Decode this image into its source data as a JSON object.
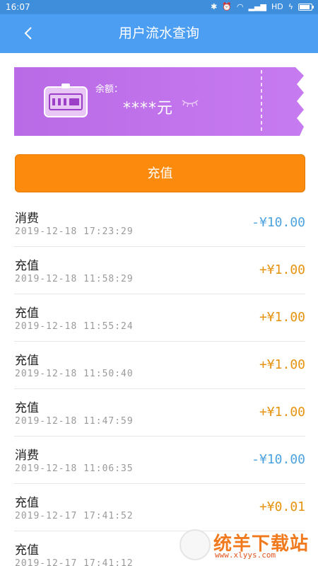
{
  "status": {
    "time": "16:07",
    "network": "HD"
  },
  "header": {
    "title": "用户流水查询"
  },
  "card": {
    "balance_label": "余额：",
    "balance_value": "****元"
  },
  "recharge_button": "充值",
  "records": [
    {
      "type": "消费",
      "date": "2019-12-18 17:23:29",
      "amount": "-¥10.00",
      "kind": "neg"
    },
    {
      "type": "充值",
      "date": "2019-12-18 11:58:29",
      "amount": "+¥1.00",
      "kind": "pos"
    },
    {
      "type": "充值",
      "date": "2019-12-18 11:55:24",
      "amount": "+¥1.00",
      "kind": "pos"
    },
    {
      "type": "充值",
      "date": "2019-12-18 11:50:40",
      "amount": "+¥1.00",
      "kind": "pos"
    },
    {
      "type": "充值",
      "date": "2019-12-18 11:47:59",
      "amount": "+¥1.00",
      "kind": "pos"
    },
    {
      "type": "消费",
      "date": "2019-12-18 11:06:35",
      "amount": "-¥10.00",
      "kind": "neg"
    },
    {
      "type": "充值",
      "date": "2019-12-17 17:41:52",
      "amount": "+¥0.01",
      "kind": "pos"
    },
    {
      "type": "充值",
      "date": "2019-12-17 17:41:12",
      "amount": "",
      "kind": "pos"
    }
  ],
  "watermark": {
    "text": "统羊下载站",
    "sub": "www.xlyys.com"
  },
  "colors": {
    "navbar": "#4c9ef2",
    "card": "#c468e8",
    "button": "#fb8a0d",
    "negative": "#4da3df",
    "positive": "#e6930f"
  }
}
